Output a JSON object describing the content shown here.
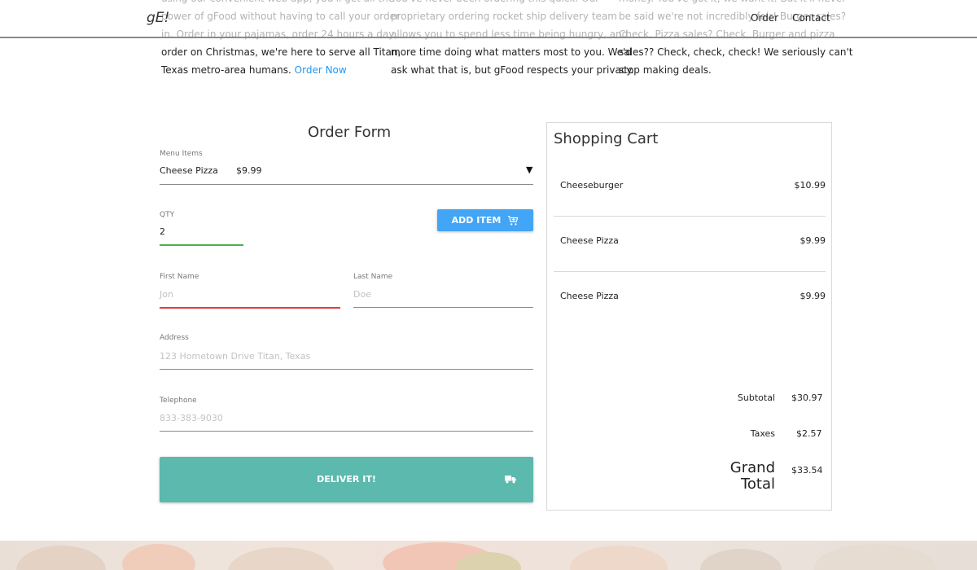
{
  "header": {
    "logo": "gE!",
    "nav": {
      "order": "Order",
      "contact": "Contact"
    }
  },
  "intro": {
    "col1": {
      "lines": [
        "using our convenient web app, you'll get all the",
        "power of gFood without having to call your order",
        "in. Order in your pajamas, order 24 hours a day,",
        "order on Christmas, we're here to serve all Titan,",
        "Texas metro-area humans."
      ],
      "link": "Order Now"
    },
    "col2": {
      "lines": [
        "You've never been ordering this quick. Our",
        "proprietary ordering rocket ship delivery team",
        "allows you to spend less time being hungry, and",
        "more time doing what matters most to you. We'd",
        "ask what that is, but gFood respects your privacy."
      ]
    },
    "col3": {
      "lines": [
        "money. You've got it, we want it. But it'll never",
        "be said we're not incredibly fair! Burger sales?",
        "Check. Pizza sales? Check. Burger and pizza",
        "sales?? Check, check, check! We seriously can't",
        "stop making deals."
      ]
    }
  },
  "order_form": {
    "title": "Order Form",
    "menu_items": {
      "label": "Menu Items",
      "selected_name": "Cheese Pizza",
      "selected_price": "$9.99"
    },
    "qty": {
      "label": "QTY",
      "value": "2"
    },
    "add_item_label": "ADD ITEM",
    "first_name": {
      "label": "First Name",
      "placeholder": "Jon"
    },
    "last_name": {
      "label": "Last Name",
      "placeholder": "Doe"
    },
    "address": {
      "label": "Address",
      "placeholder": "123 Hometown Drive Titan, Texas"
    },
    "telephone": {
      "label": "Telephone",
      "placeholder": "833-383-9030"
    },
    "deliver_label": "DELIVER IT!",
    "colors": {
      "qty_underline": "#4caf50",
      "first_name_underline": "#e53935",
      "add_button": "#42a5f5",
      "deliver_button": "#5bb9ad"
    }
  },
  "cart": {
    "title": "Shopping Cart",
    "items": [
      {
        "name": "Cheeseburger",
        "price": "$10.99"
      },
      {
        "name": "Cheese Pizza",
        "price": "$9.99"
      },
      {
        "name": "Cheese Pizza",
        "price": "$9.99"
      }
    ],
    "subtotal_label": "Subtotal",
    "subtotal": "$30.97",
    "taxes_label": "Taxes",
    "taxes": "$2.57",
    "grand_total_label_1": "Grand",
    "grand_total_label_2": "Total",
    "grand_total": "$33.54"
  }
}
